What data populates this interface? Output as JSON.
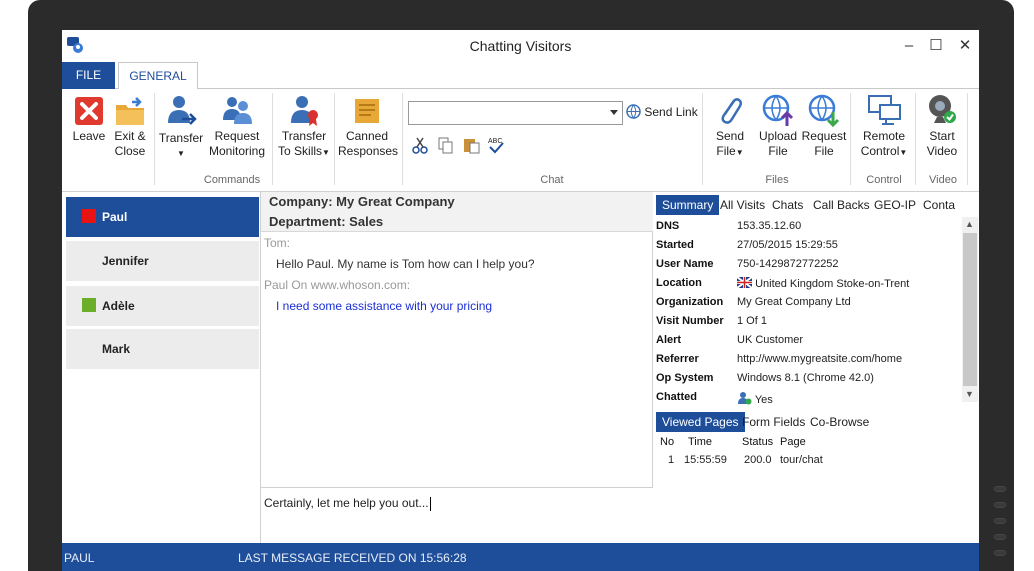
{
  "window": {
    "title": "Chatting Visitors"
  },
  "tabs": {
    "file": "FILE",
    "general": "GENERAL"
  },
  "ribbon": {
    "leave": "Leave",
    "exit_close_1": "Exit &",
    "exit_close_2": "Close",
    "transfer": "Transfer",
    "request_monitoring_1": "Request",
    "request_monitoring_2": "Monitoring",
    "transfer_skills_1": "Transfer",
    "transfer_skills_2": "To Skills",
    "canned_1": "Canned",
    "canned_2": "Responses",
    "send_link": "Send Link",
    "send_file_1": "Send",
    "send_file_2": "File",
    "upload_file_1": "Upload",
    "upload_file_2": "File",
    "request_file_1": "Request",
    "request_file_2": "File",
    "remote_control_1": "Remote",
    "remote_control_2": "Control",
    "start_video_1": "Start",
    "start_video_2": "Video",
    "groups": {
      "commands": "Commands",
      "chat": "Chat",
      "files": "Files",
      "control": "Control",
      "video": "Video"
    }
  },
  "visitors": [
    {
      "name": "Paul",
      "color": "#e81414",
      "selected": true
    },
    {
      "name": "Jennifer",
      "color": "",
      "selected": false
    },
    {
      "name": "Adèle",
      "color": "#6aae2a",
      "selected": false
    },
    {
      "name": "Mark",
      "color": "",
      "selected": false
    }
  ],
  "chat": {
    "company": "Company: My Great Company",
    "department": "Department: Sales",
    "messages": [
      {
        "from": "Tom:",
        "text": "Hello Paul. My name is Tom how can I help you?",
        "color": "#333333"
      },
      {
        "from": "Paul On www.whoson.com:",
        "text": "I need some assistance with your pricing",
        "color": "#1a2fd6"
      }
    ],
    "compose": "Certainly, let me help you out..."
  },
  "details": {
    "tabs": [
      "Summary",
      "All Visits",
      "Chats",
      "Call Backs",
      "GEO-IP",
      "Conta"
    ],
    "rows": [
      {
        "key": "DNS",
        "value": "153.35.12.60"
      },
      {
        "key": "Started",
        "value": "27/05/2015 15:29:55"
      },
      {
        "key": "User Name",
        "value": "750-1429872772252"
      },
      {
        "key": "Location",
        "value": "United Kingdom Stoke-on-Trent"
      },
      {
        "key": "Organization",
        "value": "My Great Company Ltd"
      },
      {
        "key": "Visit Number",
        "value": "1 Of 1"
      },
      {
        "key": "Alert",
        "value": "UK Customer"
      },
      {
        "key": "Referrer",
        "value": "http://www.mygreatsite.com/home"
      },
      {
        "key": "Op System",
        "value": "Windows 8.1 (Chrome 42.0)"
      },
      {
        "key": "Chatted",
        "value": "Yes"
      }
    ],
    "view_tabs": [
      "Viewed Pages",
      "Form Fields",
      "Co-Browse"
    ],
    "pages_head": {
      "no": "No",
      "time": "Time",
      "status": "Status",
      "page": "Page"
    },
    "pages": [
      {
        "no": "1",
        "time": "15:55:59",
        "status": "200.0",
        "page": "tour/chat"
      }
    ]
  },
  "status": {
    "user": "PAUL",
    "last_message": "LAST MESSAGE RECEIVED ON 15:56:28"
  },
  "colors": {
    "accent": "#1e4e9a"
  }
}
